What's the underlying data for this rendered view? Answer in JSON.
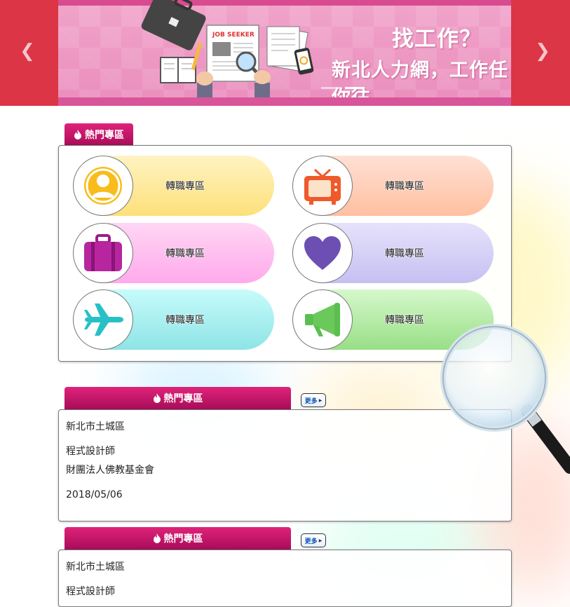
{
  "banner": {
    "title": "找工作？",
    "subtitle": "新北人力網，工作任你往",
    "illustration_text": "JOB SEEKER",
    "prev_icon": "chevron-left-icon",
    "next_icon": "chevron-right-icon",
    "slides": 2,
    "active_slide": 2,
    "colors": {
      "side": "#dc3545",
      "main": "#ea8dbd"
    }
  },
  "hot_zone": {
    "heading": "熱門專區",
    "items": [
      {
        "label": "轉職專區",
        "icon": "person-icon",
        "color": "#fde58b"
      },
      {
        "label": "轉職專區",
        "icon": "tv-icon",
        "color": "#ffc4a8"
      },
      {
        "label": "轉職專區",
        "icon": "briefcase-icon",
        "color": "#ffb8f0"
      },
      {
        "label": "轉職專區",
        "icon": "heart-icon",
        "color": "#cfcaf6"
      },
      {
        "label": "轉職專區",
        "icon": "airplane-icon",
        "color": "#a5eef0"
      },
      {
        "label": "轉職專區",
        "icon": "megaphone-icon",
        "color": "#a8e59a"
      }
    ]
  },
  "job_sections": [
    {
      "heading": "熱門專區",
      "more": "更多",
      "district": "新北市土城區",
      "position": "程式設計師",
      "company": "財團法人佛教基金會",
      "date": "2018/05/06"
    },
    {
      "heading": "熱門專區",
      "more": "更多",
      "district": "新北市土城區",
      "position": "程式設計師"
    }
  ]
}
